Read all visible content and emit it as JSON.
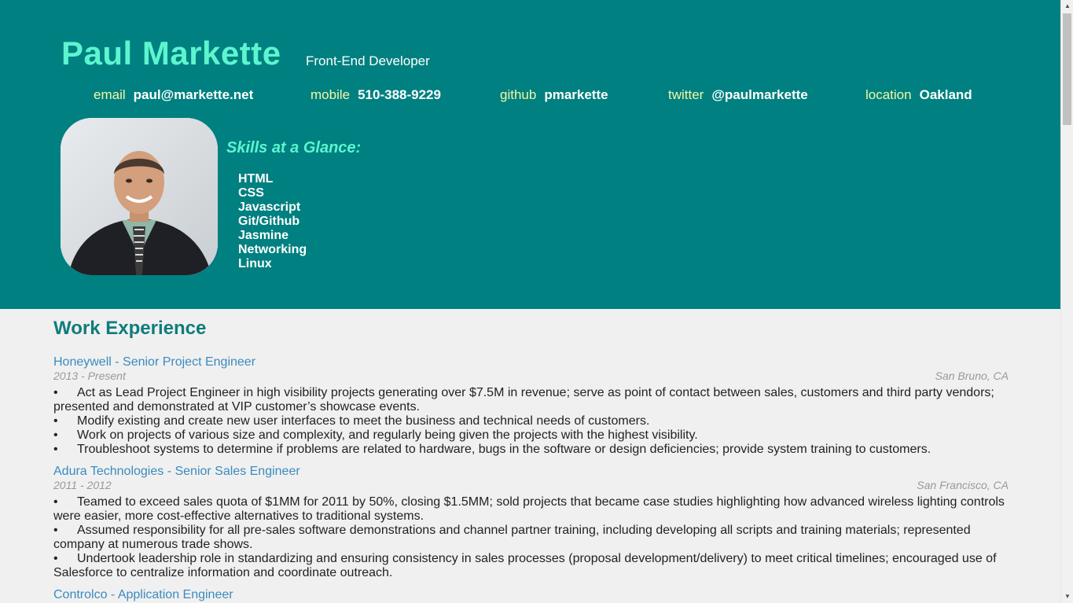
{
  "header": {
    "name": "Paul Markette",
    "role": "Front-End Developer",
    "contacts": [
      {
        "label": "email",
        "value": "paul@markette.net"
      },
      {
        "label": "mobile",
        "value": "510-388-9229"
      },
      {
        "label": "github",
        "value": "pmarkette"
      },
      {
        "label": "twitter",
        "value": "@paulmarkette"
      },
      {
        "label": "location",
        "value": "Oakland"
      }
    ]
  },
  "skills": {
    "title": "Skills at a Glance:",
    "items": [
      "HTML",
      "CSS",
      "Javascript",
      "Git/Github",
      "Jasmine",
      "Networking",
      "Linux"
    ]
  },
  "work": {
    "title": "Work Experience",
    "jobs": [
      {
        "title": "Honeywell - Senior Project Engineer",
        "dates": "2013 - Present",
        "location": "San Bruno, CA",
        "bullets": [
          "Act as Lead Project Engineer in high visibility projects generating over $7.5M in revenue; serve as point of contact between sales, customers and third party vendors; presented and demonstrated at VIP customer’s showcase events.",
          "Modify existing and create new user interfaces to meet the business and technical needs of customers.",
          "Work on projects of various size and complexity, and regularly being given the projects with the highest visibility.",
          "Troubleshoot systems to determine if problems are related to hardware, bugs in the software or design deficiencies; provide system training to customers."
        ]
      },
      {
        "title": "Adura Technologies - Senior Sales Engineer",
        "dates": "2011 - 2012",
        "location": "San Francisco, CA",
        "bullets": [
          "Teamed to exceed sales quota of $1MM for 2011 by 50%, closing $1.5MM; sold projects that became case studies highlighting how advanced wireless lighting controls were easier, more cost-effective alternatives to traditional systems.",
          "Assumed responsibility for all pre-sales software demonstrations and channel partner training, including developing all scripts and training materials; represented company at numerous trade shows.",
          "Undertook leadership role in standardizing and ensuring consistency in sales processes (proposal development/delivery) to meet critical timelines; encouraged use of Salesforce to centralize information and coordinate outreach."
        ]
      },
      {
        "title": "Controlco - Application Engineer"
      }
    ]
  },
  "colors": {
    "header_bg": "#008080",
    "name": "#5cf5cf",
    "contact_label": "#f2f7a6",
    "link": "#3a8bbf",
    "section_heading": "#107c7c"
  }
}
